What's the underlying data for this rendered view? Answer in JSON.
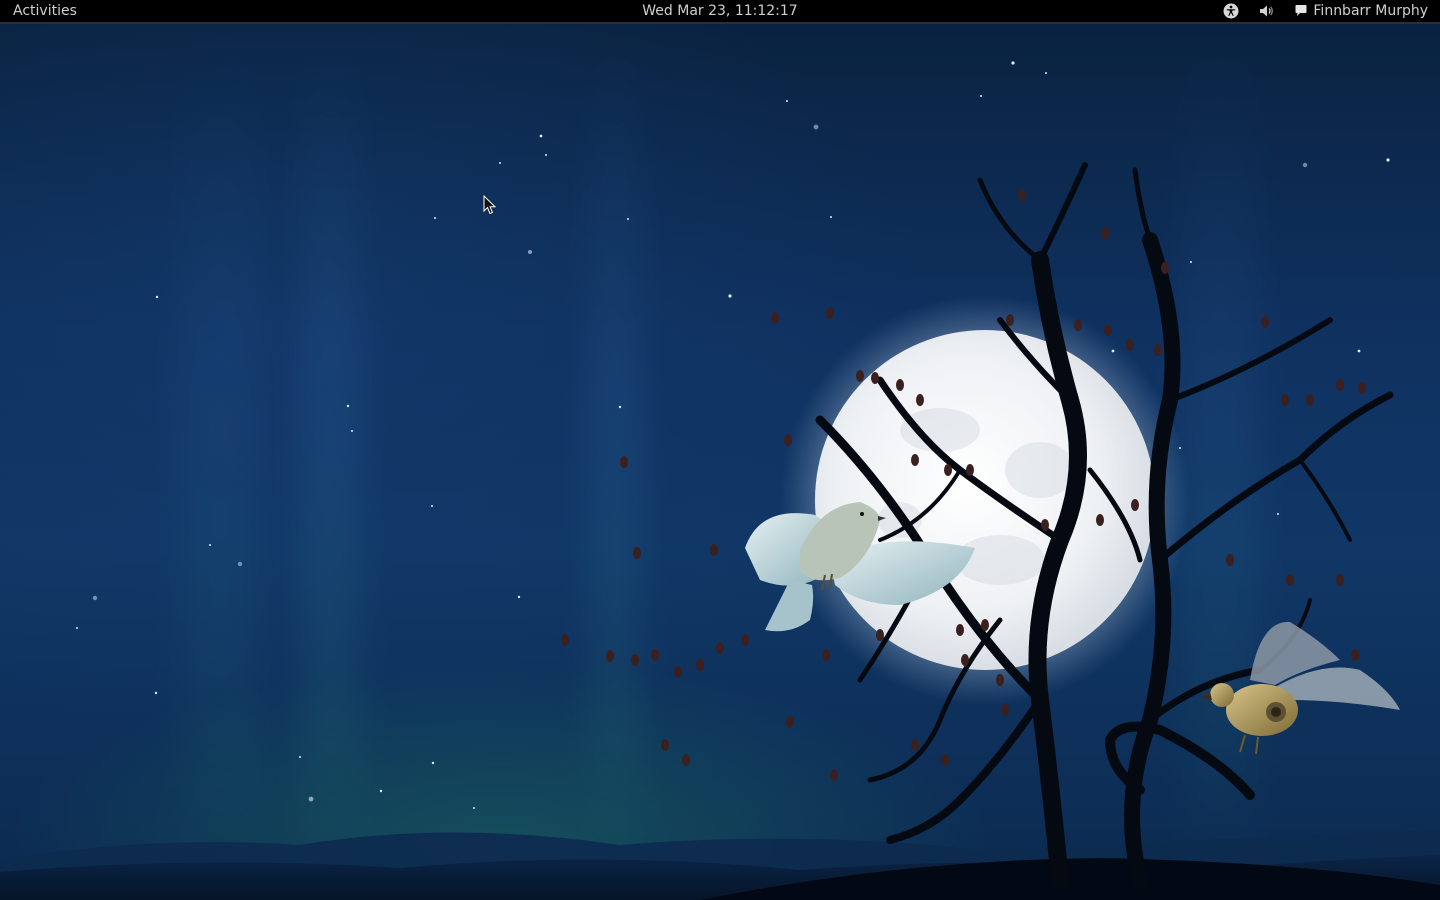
{
  "panel": {
    "activities_label": "Activities",
    "clock": "Wed Mar 23, 11:12:17",
    "accessibility_icon": "accessibility-icon",
    "volume_icon": "volume-icon",
    "user_icon": "chat-bubble-icon",
    "user_name": "Finnbarr Murphy"
  },
  "colors": {
    "panel_bg": "#000000",
    "panel_text": "#cfcfcf",
    "sky": "#0f3160",
    "moon": "#f2f4f6"
  }
}
